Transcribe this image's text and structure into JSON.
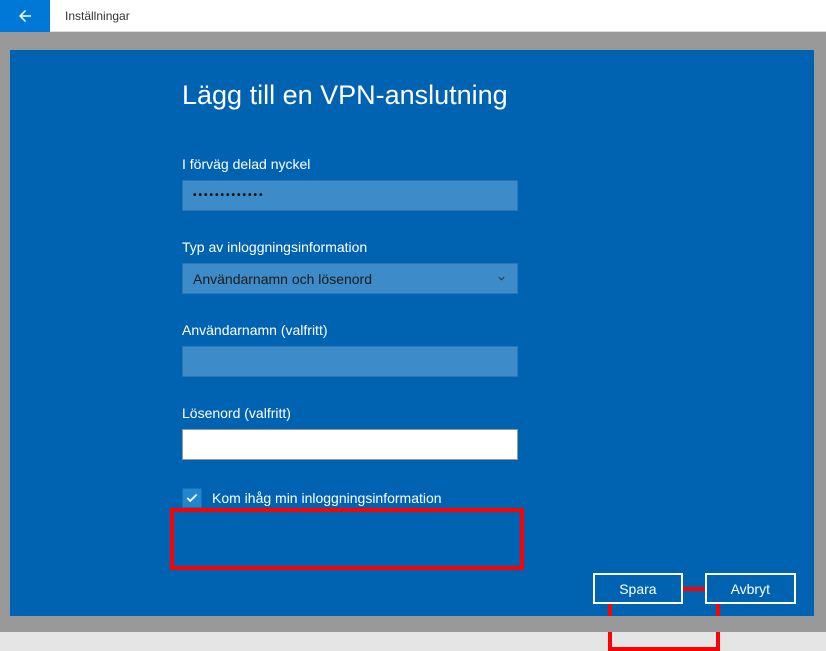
{
  "titlebar": {
    "title": "Inställningar"
  },
  "page": {
    "heading": "Lägg till en VPN-anslutning"
  },
  "fields": {
    "presharedKey": {
      "label": "I förväg delad nyckel",
      "value": "•••••••••••••"
    },
    "signInType": {
      "label": "Typ av inloggningsinformation",
      "selected": "Användarnamn och lösenord"
    },
    "username": {
      "label": "Användarnamn (valfritt)",
      "value": ""
    },
    "password": {
      "label": "Lösenord (valfritt)",
      "value": ""
    },
    "remember": {
      "label": "Kom ihåg min inloggningsinformation",
      "checked": true
    }
  },
  "buttons": {
    "save": "Spara",
    "cancel": "Avbryt"
  }
}
